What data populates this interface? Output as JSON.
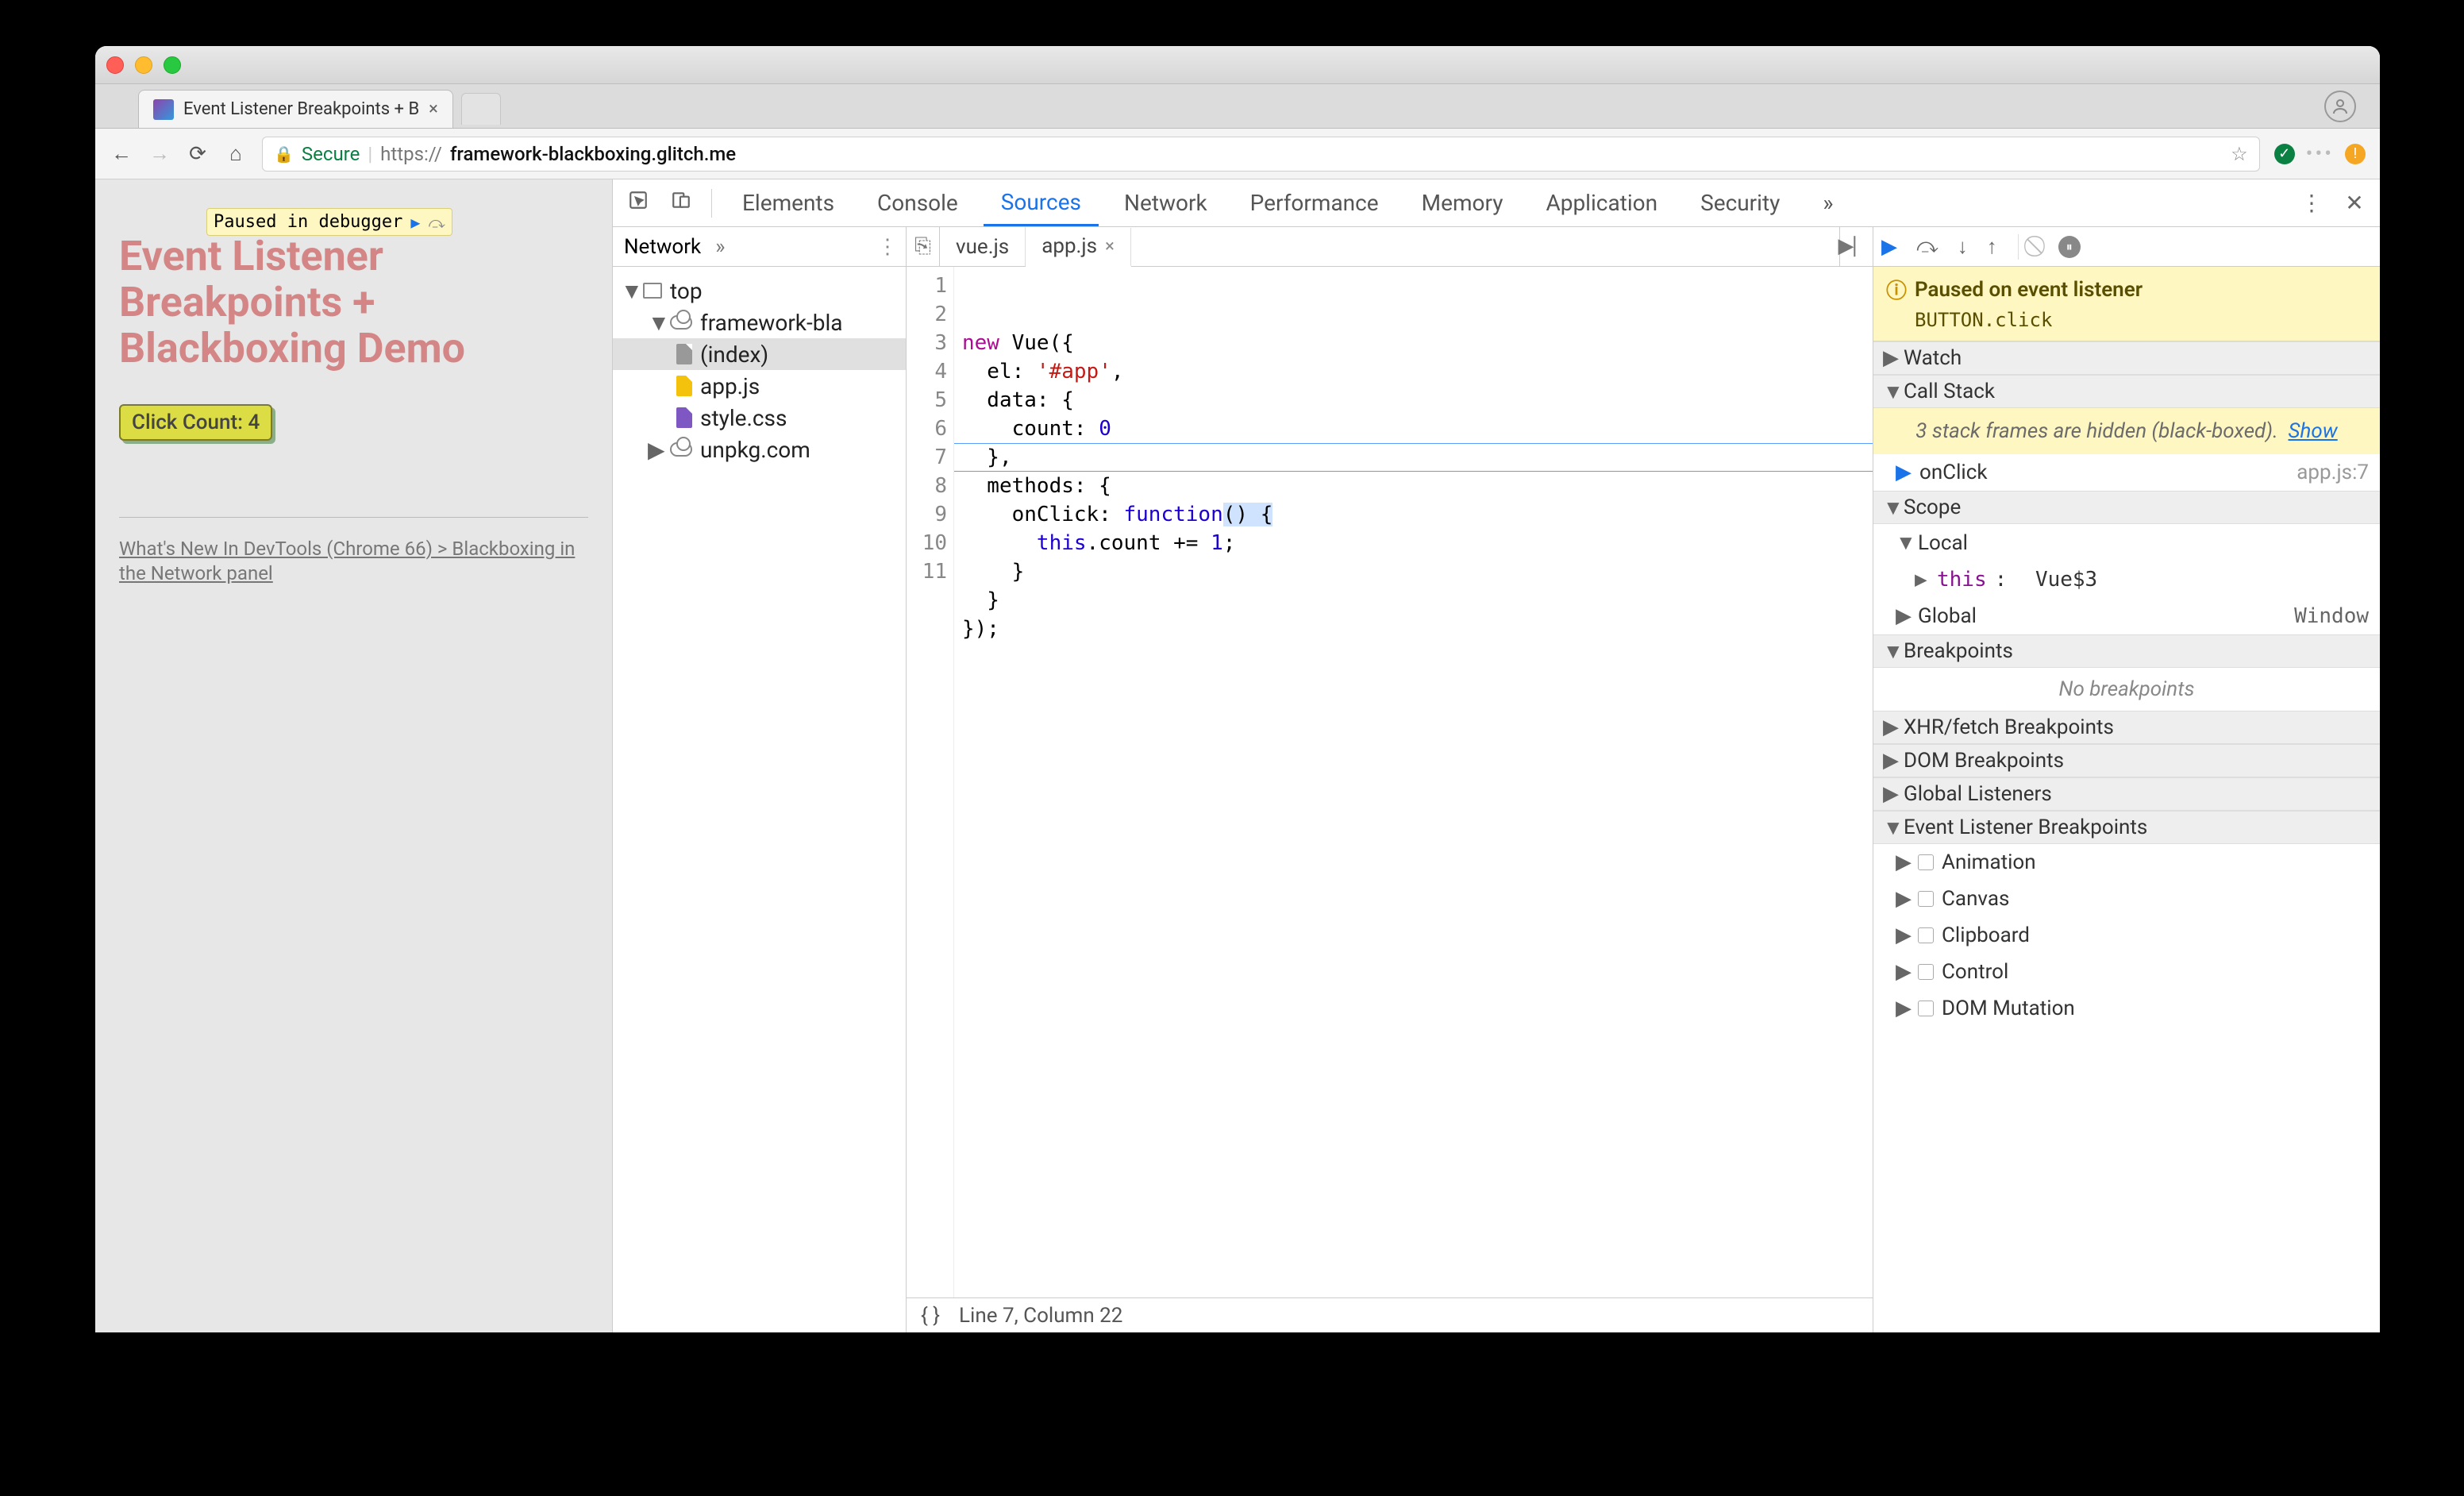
{
  "browser": {
    "tab_title": "Event Listener Breakpoints + B",
    "secure_label": "Secure",
    "url_scheme": "https://",
    "url_host": "framework-blackboxing.glitch.me"
  },
  "page": {
    "paused_chip": "Paused in debugger",
    "title_line1": "Event Listener",
    "title_line2": "Breakpoints +",
    "title_line3": "Blackboxing Demo",
    "button_label": "Click Count: 4",
    "ref_link": "What's New In DevTools (Chrome 66) > Blackboxing in the Network panel"
  },
  "devtools": {
    "tabs": [
      "Elements",
      "Console",
      "Sources",
      "Network",
      "Performance",
      "Memory",
      "Application",
      "Security"
    ],
    "active_tab": "Sources",
    "navigator": {
      "header": "Network",
      "tree": {
        "top": "top",
        "domain": "framework-bla",
        "files": [
          "(index)",
          "app.js",
          "style.css"
        ],
        "external": "unpkg.com"
      }
    },
    "code_tabs": [
      "vue.js",
      "app.js"
    ],
    "active_code_tab": "app.js",
    "code_lines": [
      "new Vue({",
      "  el: '#app',",
      "  data: {",
      "    count: 0",
      "  },",
      "  methods: {",
      "    onClick: function() {",
      "      this.count += 1;",
      "    }",
      "  }",
      "});"
    ],
    "status_line": "Line 7, Column 22",
    "current_line": 7,
    "debugger": {
      "paused_header": "Paused on event listener",
      "paused_detail": "BUTTON.click",
      "watch": "Watch",
      "callstack": "Call Stack",
      "hidden_frames": "3 stack frames are hidden (black-boxed).",
      "hidden_show": "Show",
      "stack": {
        "name": "onClick",
        "location": "app.js:7"
      },
      "scope": "Scope",
      "local_label": "Local",
      "local_this_key": "this",
      "local_this_val": "Vue$3",
      "global_label": "Global",
      "global_val": "Window",
      "breakpoints": "Breakpoints",
      "no_breakpoints": "No breakpoints",
      "xhr": "XHR/fetch Breakpoints",
      "dom": "DOM Breakpoints",
      "global_listeners": "Global Listeners",
      "event_bp": "Event Listener Breakpoints",
      "events": [
        "Animation",
        "Canvas",
        "Clipboard",
        "Control",
        "DOM Mutation"
      ]
    }
  }
}
